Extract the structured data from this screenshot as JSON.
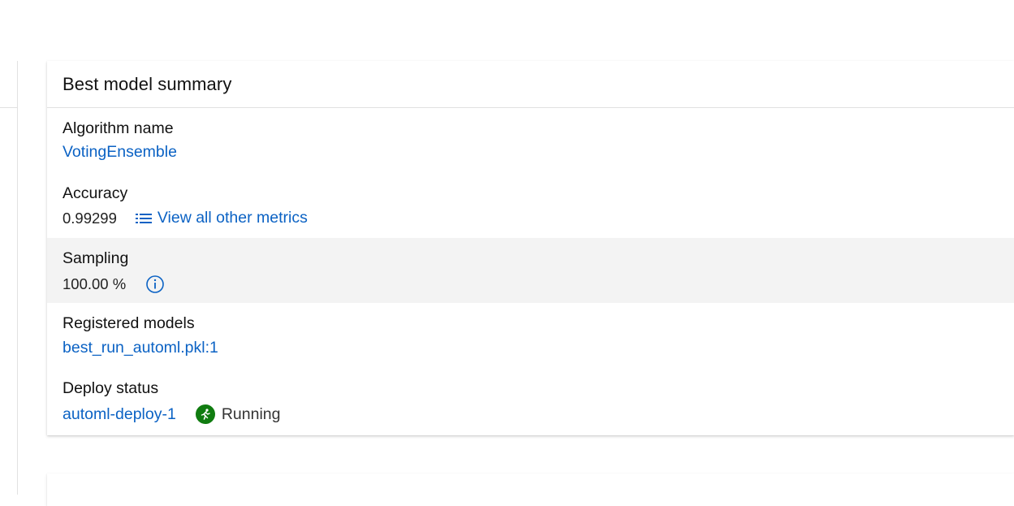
{
  "card": {
    "title": "Best model summary",
    "algorithm": {
      "label": "Algorithm name",
      "value": "VotingEnsemble"
    },
    "accuracy": {
      "label": "Accuracy",
      "value": "0.99299",
      "metrics_link": "View all other metrics"
    },
    "sampling": {
      "label": "Sampling",
      "value": "100.00 %"
    },
    "registered_models": {
      "label": "Registered models",
      "value": "best_run_automl.pkl:1"
    },
    "deploy_status": {
      "label": "Deploy status",
      "endpoint": "automl-deploy-1",
      "status": "Running"
    }
  },
  "colors": {
    "link": "#0b62c4",
    "running": "#107c10",
    "shaded_row": "#f3f3f3"
  }
}
